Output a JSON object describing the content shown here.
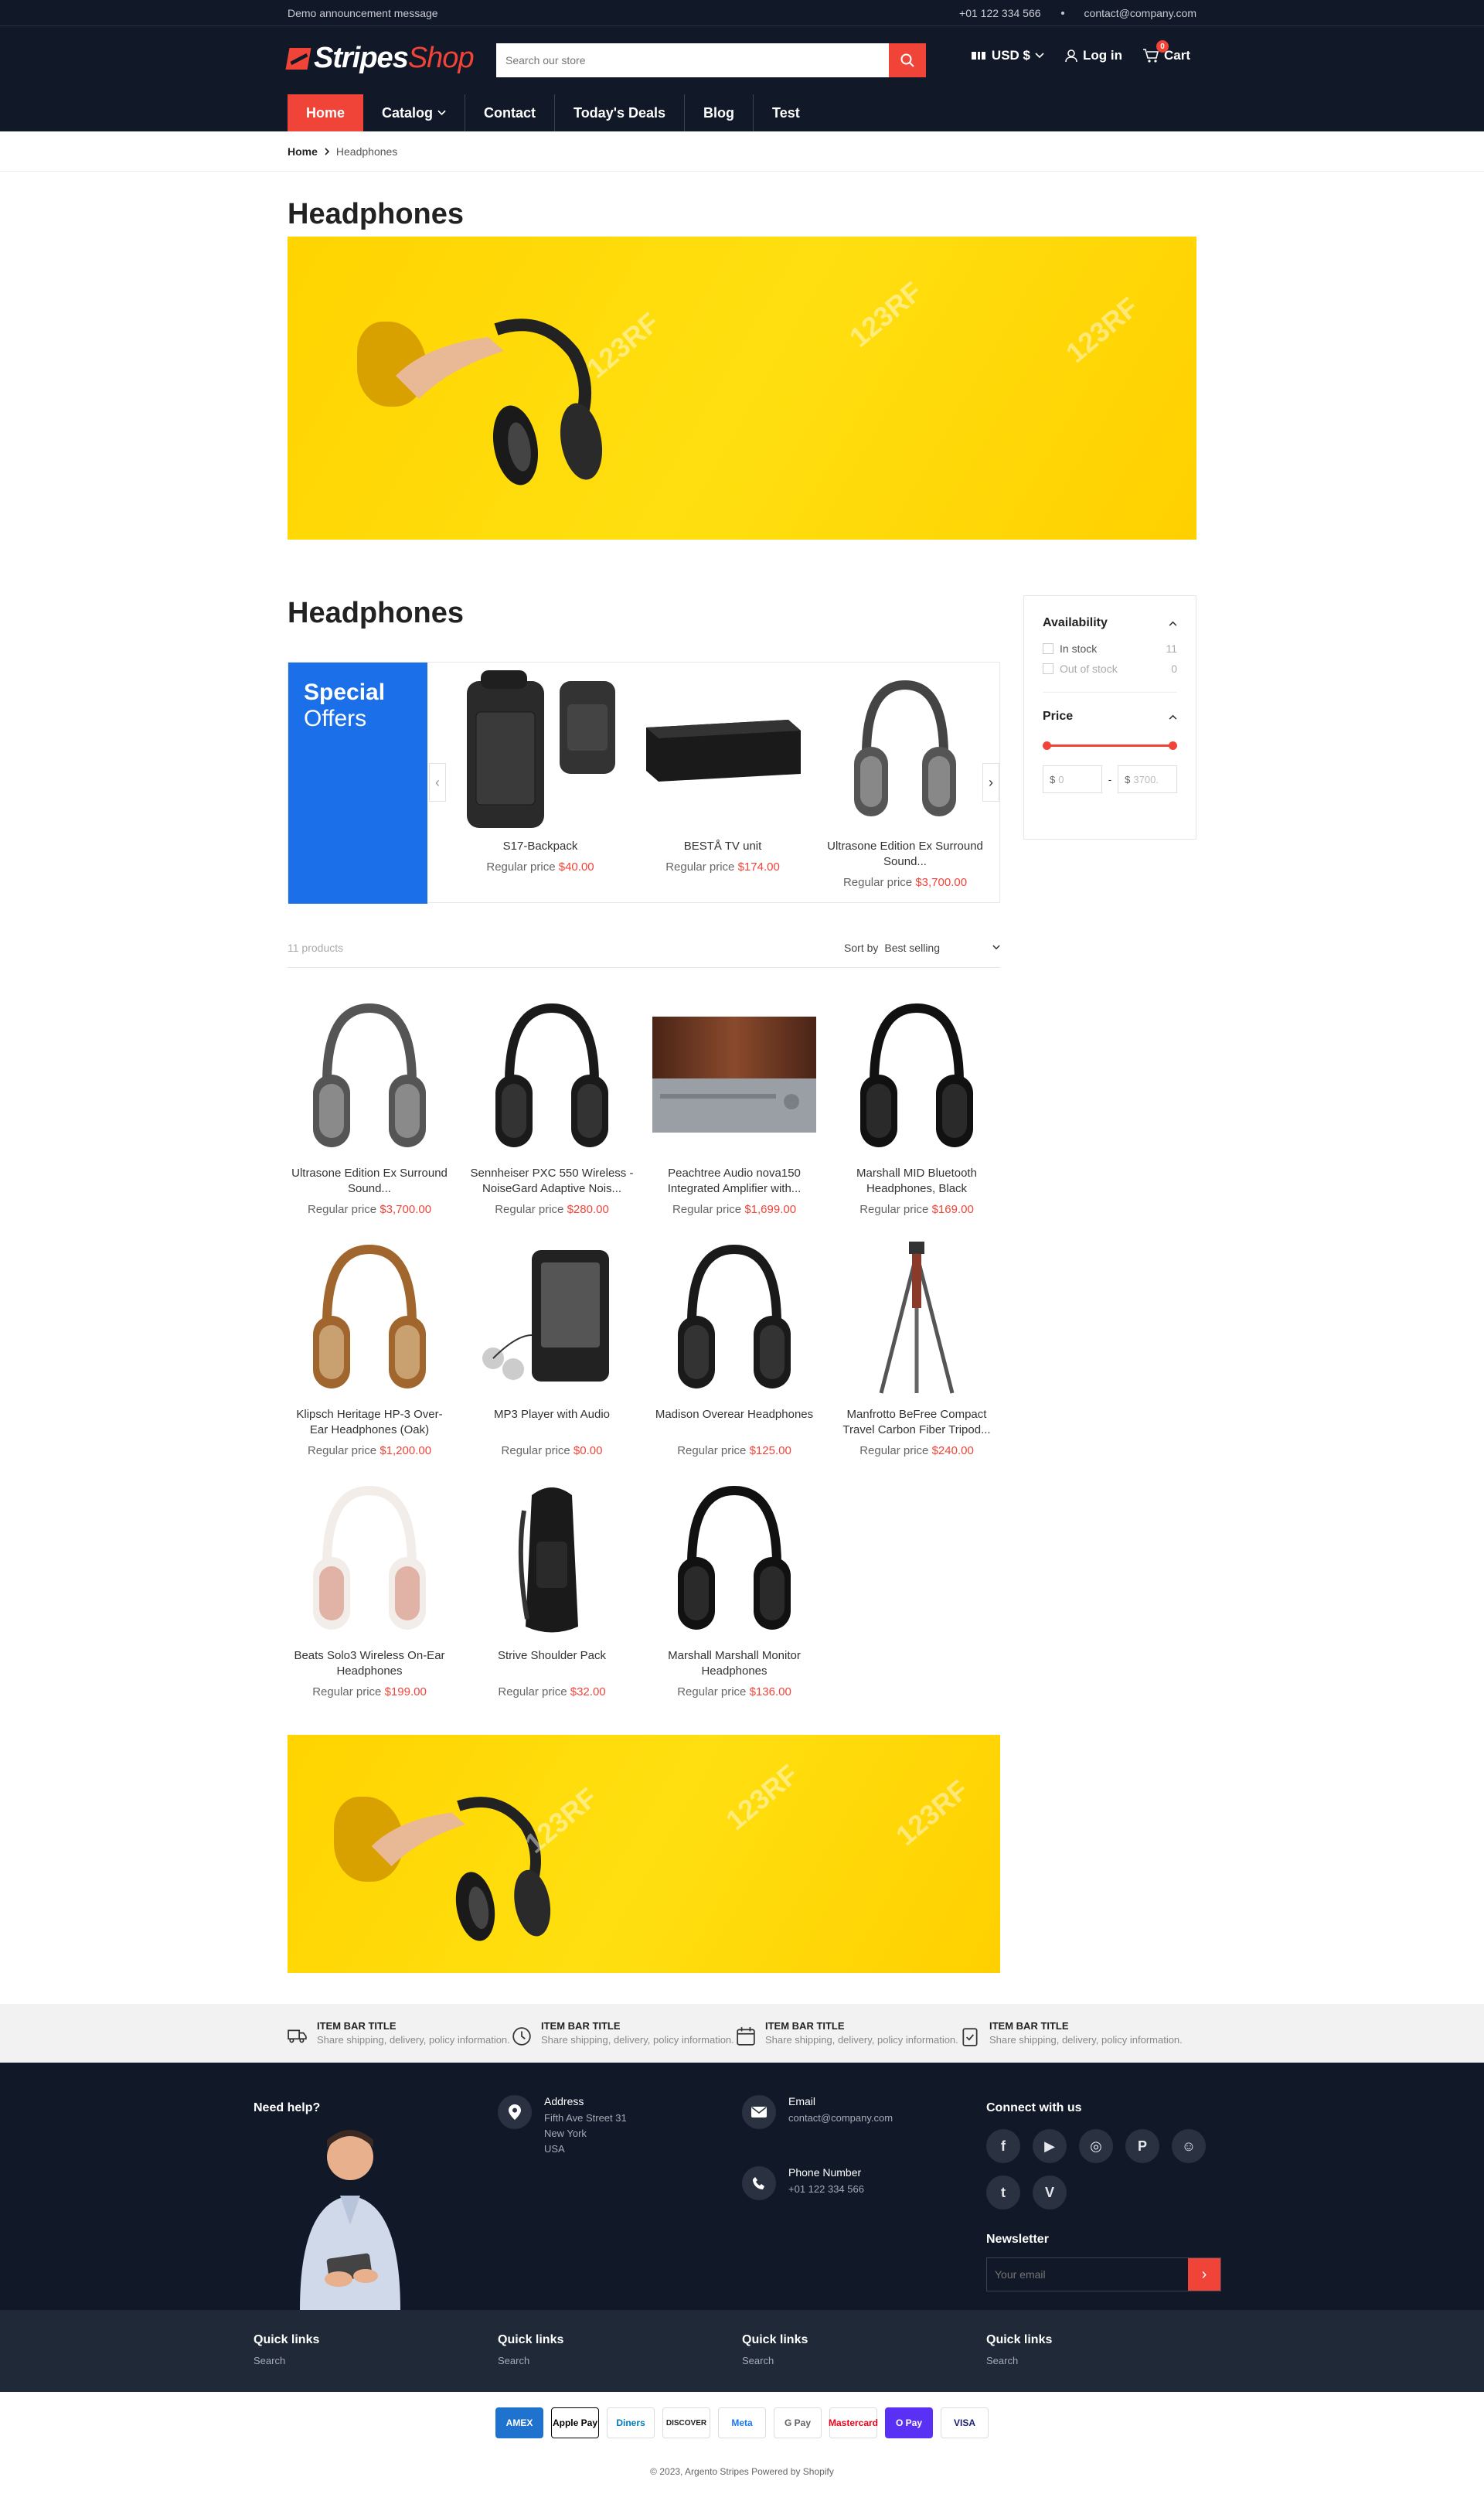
{
  "announcement": "Demo announcement message",
  "topbar": {
    "phone": "+01 122 334 566",
    "email": "contact@company.com"
  },
  "logo": {
    "part1": "Stripes",
    "part2": "Shop"
  },
  "search": {
    "placeholder": "Search our store"
  },
  "header": {
    "currency": "USD $",
    "login": "Log in",
    "cart": "Cart",
    "cart_count": "0"
  },
  "nav": [
    "Home",
    "Catalog",
    "Contact",
    "Today's Deals",
    "Blog",
    "Test"
  ],
  "breadcrumb": {
    "home": "Home",
    "current": "Headphones"
  },
  "page_title": "Headphones",
  "collection_title": "Headphones",
  "special": {
    "line1": "Special",
    "line2": "Offers",
    "price_label": "Regular price",
    "items": [
      {
        "name": "S17-Backpack",
        "price": "$40.00"
      },
      {
        "name": "BESTÅ TV unit",
        "price": "$174.00"
      },
      {
        "name": "Ultrasone Edition Ex Surround Sound...",
        "price": "$3,700.00"
      }
    ]
  },
  "toolbar": {
    "count": "11 products",
    "sort_label": "Sort by",
    "sort_value": "Best selling"
  },
  "products": [
    {
      "name": "Ultrasone Edition Ex Surround Sound...",
      "price": "$3,700.00",
      "icon": "headphones-silver"
    },
    {
      "name": "Sennheiser PXC 550 Wireless - NoiseGard Adaptive Nois...",
      "price": "$280.00",
      "icon": "headphones-black"
    },
    {
      "name": "Peachtree Audio nova150 Integrated Amplifier with...",
      "price": "$1,699.00",
      "icon": "amplifier"
    },
    {
      "name": "Marshall MID Bluetooth Headphones, Black",
      "price": "$169.00",
      "icon": "headphones-marshall"
    },
    {
      "name": "Klipsch Heritage HP-3 Over-Ear Headphones (Oak)",
      "price": "$1,200.00",
      "icon": "headphones-oak"
    },
    {
      "name": "MP3 Player with Audio",
      "price": "$0.00",
      "icon": "mp3-player"
    },
    {
      "name": "Madison Overear Headphones",
      "price": "$125.00",
      "icon": "headphones-black"
    },
    {
      "name": "Manfrotto BeFree Compact Travel Carbon Fiber Tripod...",
      "price": "$240.00",
      "icon": "tripod"
    },
    {
      "name": "Beats Solo3 Wireless On-Ear Headphones",
      "price": "$199.00",
      "icon": "headphones-pink"
    },
    {
      "name": "Strive Shoulder Pack",
      "price": "$32.00",
      "icon": "backpack"
    },
    {
      "name": "Marshall Marshall Monitor Headphones",
      "price": "$136.00",
      "icon": "headphones-marshall"
    }
  ],
  "price_label": "Regular price",
  "filters": {
    "availability": "Availability",
    "in_stock": "In stock",
    "in_stock_count": "11",
    "out_stock": "Out of stock",
    "out_stock_count": "0",
    "price": "Price",
    "min_prefix": "$",
    "min_placeholder": "0",
    "max_prefix": "$",
    "max_placeholder": "3700.",
    "dash": "-"
  },
  "itembar": [
    {
      "title": "ITEM BAR TITLE",
      "desc": "Share shipping, delivery, policy information.",
      "icon": "truck-icon"
    },
    {
      "title": "ITEM BAR TITLE",
      "desc": "Share shipping, delivery, policy information.",
      "icon": "clock-icon"
    },
    {
      "title": "ITEM BAR TITLE",
      "desc": "Share shipping, delivery, policy information.",
      "icon": "calendar-icon"
    },
    {
      "title": "ITEM BAR TITLE",
      "desc": "Share shipping, delivery, policy information.",
      "icon": "clipboard-icon"
    }
  ],
  "footer": {
    "need_help": "Need help?",
    "address_title": "Address",
    "address_lines": [
      "Fifth Ave Street 31",
      "New York",
      "USA"
    ],
    "email_title": "Email",
    "email": "contact@company.com",
    "phone_title": "Phone Number",
    "phone": "+01 122 334 566",
    "connect": "Connect with us",
    "newsletter": "Newsletter",
    "newsletter_placeholder": "Your email"
  },
  "quick_links": [
    {
      "title": "Quick links",
      "link": "Search"
    },
    {
      "title": "Quick links",
      "link": "Search"
    },
    {
      "title": "Quick links",
      "link": "Search"
    },
    {
      "title": "Quick links",
      "link": "Search"
    }
  ],
  "payments": [
    "AMEX",
    "Apple Pay",
    "Diners",
    "DISCOVER",
    "Meta",
    "G Pay",
    "Mastercard",
    "O Pay",
    "VISA"
  ],
  "copyright": "© 2023, Argento Stripes Powered by Shopify",
  "colors": {
    "accent": "#f04438",
    "dark": "#111827",
    "blue": "#1b6fe8",
    "banner": "#ffd400"
  }
}
